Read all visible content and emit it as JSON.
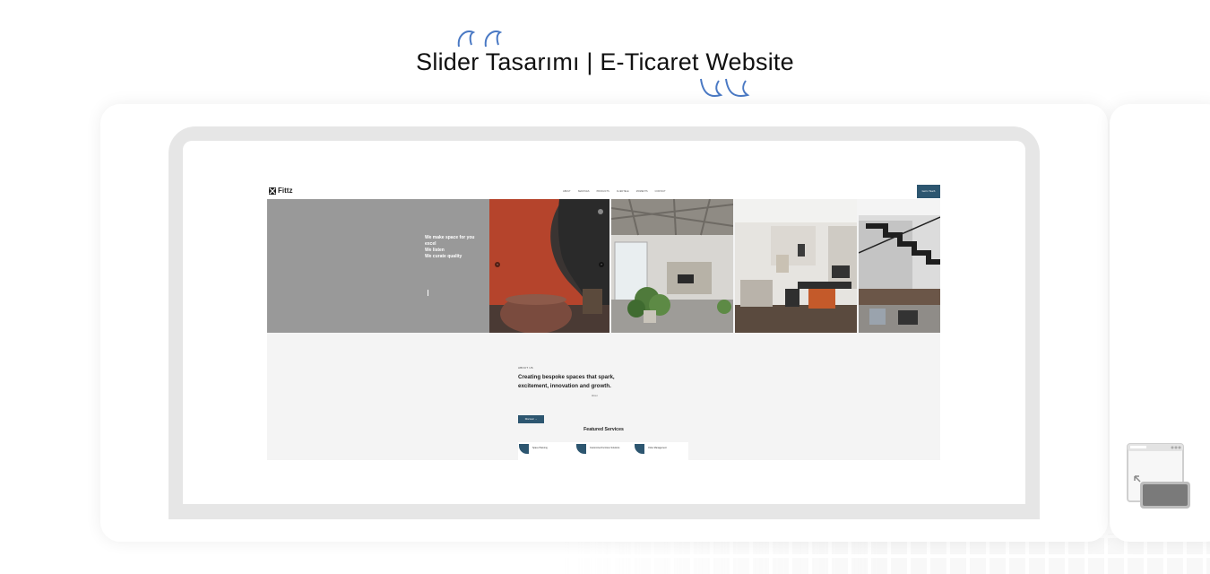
{
  "page": {
    "title": "Slider Tasarımı | E-Ticaret Website"
  },
  "colors": {
    "accent": "#2d5670",
    "hero_grey": "#999999",
    "laptop_frame": "#e6e6e6",
    "quote_blue": "#4a79c4"
  },
  "icons": {
    "quote_open": "quote-open-icon",
    "quote_close": "quote-close-icon",
    "side": "responsive-devices-icon"
  },
  "site": {
    "logo_text": "Fittz",
    "nav_links": [
      "ABOUT",
      "SERVICES",
      "PRODUCTS",
      "CLIENTELE",
      "MOMENTS",
      "CONTACT"
    ],
    "cta": "Get In Touch",
    "hero": {
      "lines": [
        "We make space for you",
        "excel",
        "We listen",
        "We curate quality"
      ]
    },
    "about": {
      "kicker": "ABOUT US",
      "heading": "Creating bespoke spaces that spark, excitement, innovation and growth.",
      "note": "About",
      "button": "Discover  →"
    },
    "services": {
      "title": "Featured Services",
      "items": [
        "Space Planning",
        "Customized Furniture Solutions",
        "Order Management"
      ]
    }
  }
}
